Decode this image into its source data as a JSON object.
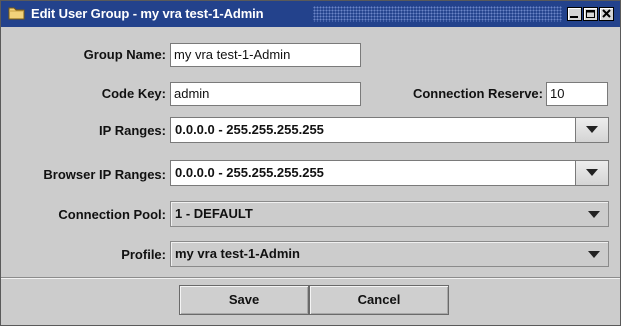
{
  "window": {
    "title": "Edit User Group - my vra test-1-Admin"
  },
  "form": {
    "group_name": {
      "label": "Group Name:",
      "value": "my vra test-1-Admin"
    },
    "code_key": {
      "label": "Code Key:",
      "value": "admin"
    },
    "connection_reserve": {
      "label": "Connection Reserve:",
      "value": "10"
    },
    "ip_ranges": {
      "label": "IP Ranges:",
      "value": "0.0.0.0 - 255.255.255.255"
    },
    "browser_ip_ranges": {
      "label": "Browser IP Ranges:",
      "value": "0.0.0.0 - 255.255.255.255"
    },
    "connection_pool": {
      "label": "Connection Pool:",
      "value": "1 - DEFAULT"
    },
    "profile": {
      "label": "Profile:",
      "value": "my vra test-1-Admin"
    }
  },
  "buttons": {
    "save": "Save",
    "cancel": "Cancel"
  },
  "icons": {
    "title": "folder-icon",
    "minimize": "minimize-icon",
    "maximize": "maximize-icon",
    "close": "close-icon",
    "dropdown": "chevron-down-icon"
  },
  "colors": {
    "title_bar": "#23428c",
    "dialog_background": "#cccccc",
    "field_background": "#ffffff"
  }
}
